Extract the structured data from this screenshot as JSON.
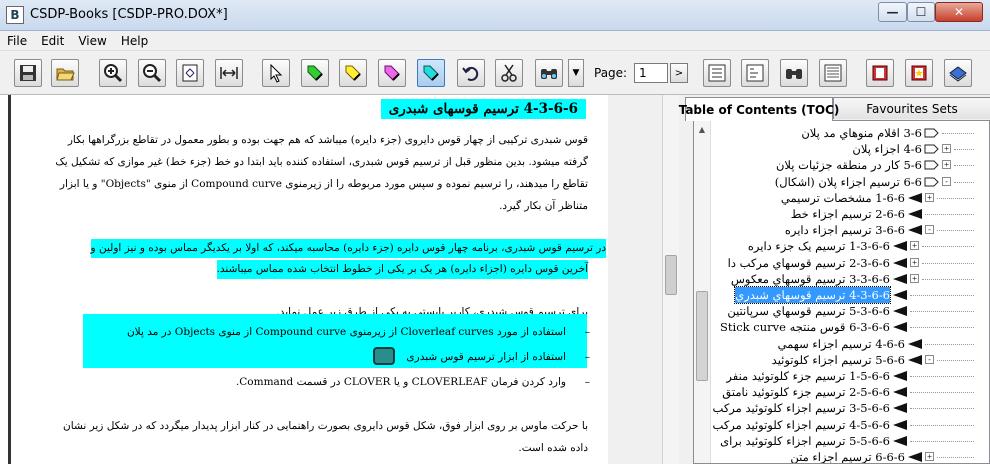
{
  "window": {
    "title": "CSDP-Books [CSDP-PRO.DOX*]",
    "app_icon_letter": "B",
    "min_glyph": "—",
    "max_glyph": "☐",
    "close_glyph": "✕"
  },
  "menu": [
    "File",
    "Edit",
    "View",
    "Help"
  ],
  "toolbar": {
    "buttons": [
      "save-icon",
      "open-folder-icon",
      "zoom-in-icon",
      "zoom-out-icon",
      "fit-page-icon",
      "fit-width-icon",
      "pointer-icon",
      "green-highlighter-icon",
      "yellow-highlighter-icon",
      "magenta-highlighter-icon",
      "cyan-highlighter-icon",
      "undo-icon",
      "cut-icon",
      "find-binoculars-icon",
      "toc-icon",
      "index-icon",
      "search-icon",
      "list-icon",
      "bookmark-icon",
      "favourite-icon",
      "print-icon"
    ],
    "page_label": "Page:",
    "page_value": "1",
    "next_glyph": ">",
    "dropdown_glyph": "▼"
  },
  "document": {
    "heading": "4-3-6-6 ترسیم قوسهای شبدری",
    "para1": [
      "قوس شبدری ترکیبی از چهار قوس دایروی (جزء دایره) میباشد که هم جهت بوده و بطور معمول در تقاطع بزرگراهها بکار",
      "گرفته میشود. بدین منظور قبل از ترسیم قوس شبدری، استفاده کننده باید ابتدا دو خط (جزء خط) غیر موازی که تشکیل یک",
      "تقاطع را میدهند، را ترسیم نموده و سپس مورد مربوطه را از زیرمنوی Compound curve از منوی \"Objects\" و یا ابزار",
      "متناظر آن بکار گیرد."
    ],
    "para2": [
      "در ترسیم قوس شبدری، برنامه چهار قوس دایره (جزء دایره) محاسبه میکند، که اولا بر یکدیگر مماس بوده و نیز اولین و",
      "آخرین قوس دایره (اجزاء دایره) هر یک بر یکی از خطوط انتخاب شده مماس میباشند."
    ],
    "para3_intro": "برای ترسیم قوس شبدری، کاربر بایستی به یکی از طرق زیر عمل نماید.",
    "bullets": [
      "استفاده از مورد Cloverleaf curves از زیرمنوی Compound curve از منوی Objects در مد پلان",
      "استفاده از ابزار ترسیم قوس شبدری",
      "وارد کردن فرمان CLOVERLEAF و یا CLOVER در قسمت Command."
    ],
    "bullet_glyph": "–",
    "para4": [
      "با حرکت ماوس بر روی ابزار فوق، شکل قوس دایروی بصورت راهنمایی در کنار ابزار پدیدار میگردد که در شکل زیر نشان",
      "داده شده است."
    ]
  },
  "toc": {
    "tabs": [
      "Table of Contents (TOC)",
      "Favourites Sets"
    ],
    "scroll_up_glyph": "▲",
    "rows": [
      {
        "text": "3-6 اقلام منوهاي مد پلان",
        "exp": "",
        "icon": "folder-icon"
      },
      {
        "text": "4-6 اجزاء پلان",
        "exp": "+",
        "icon": "folder-icon"
      },
      {
        "text": "5-6 کار در منطقه جزئيات پلان",
        "exp": "+",
        "icon": "folder-icon"
      },
      {
        "text": "6-6 ترسيم اجزاء پلان (اشکال)",
        "exp": "-",
        "icon": "folder-icon"
      },
      {
        "text": "1-6-6 مشخصات ترسيمي",
        "exp": "+",
        "icon": "page-icon"
      },
      {
        "text": "2-6-6 ترسيم اجزاء خط",
        "exp": "",
        "icon": "page-icon"
      },
      {
        "text": "3-6-6 ترسيم اجزاء دايره",
        "exp": "-",
        "icon": "page-icon"
      },
      {
        "text": "1-3-6-6 ترسيم يک جزء دايره",
        "exp": "+",
        "icon": "page-icon"
      },
      {
        "text": "2-3-6-6 ترسيم قوسهاي مرکب دا",
        "exp": "+",
        "icon": "page-icon"
      },
      {
        "text": "3-3-6-6 ترسيم قوسهاي معکوس",
        "exp": "+",
        "icon": "page-icon"
      },
      {
        "text": "4-3-6-6 ترسيم قوسهاي شبدري",
        "exp": "",
        "icon": "page-icon",
        "selected": true
      },
      {
        "text": "5-3-6-6 ترسيم قوسهاي سرپانتين",
        "exp": "",
        "icon": "page-icon"
      },
      {
        "text": "6-3-6-6 قوس منتجه Stick curve",
        "exp": "",
        "icon": "page-icon"
      },
      {
        "text": "4-6-6 ترسيم اجزاء سهمي",
        "exp": "",
        "icon": "page-icon"
      },
      {
        "text": "5-6-6 ترسيم اجزاء کلوتوئيد",
        "exp": "-",
        "icon": "page-icon"
      },
      {
        "text": "1-5-6-6 ترسيم جزء کلوتوئيد منفر",
        "exp": "",
        "icon": "page-icon"
      },
      {
        "text": "2-5-6-6 ترسيم جزء کلوتوئيد نامتق",
        "exp": "",
        "icon": "page-icon"
      },
      {
        "text": "3-5-6-6 ترسيم اجزاء کلوتوئيد مرکب",
        "exp": "",
        "icon": "page-icon"
      },
      {
        "text": "4-5-6-6 ترسيم اجزاء کلوتوئيد مرکب",
        "exp": "",
        "icon": "page-icon"
      },
      {
        "text": "5-5-6-6 ترسيم اجزاء کلوتوئيد برای",
        "exp": "",
        "icon": "page-icon"
      },
      {
        "text": "6-6-6 ترسيم اجزاء متن",
        "exp": "+",
        "icon": "page-icon"
      }
    ]
  }
}
